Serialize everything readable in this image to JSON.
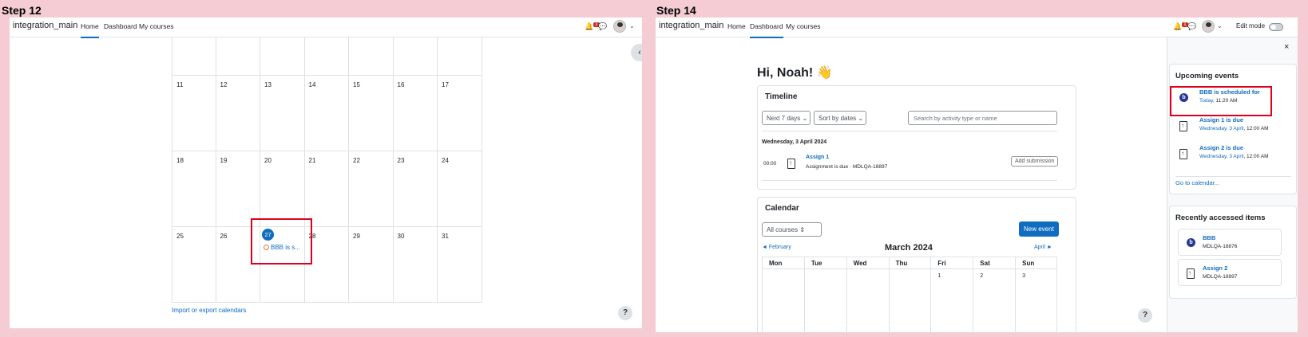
{
  "step12": {
    "label": "Step 12",
    "navbar": {
      "site_name": "integration_main",
      "items": [
        "Home",
        "Dashboard",
        "My courses"
      ],
      "notifications_count": "1"
    },
    "calendar_rows": [
      [
        "",
        "",
        "",
        "",
        "",
        "",
        ""
      ],
      [
        "11",
        "12",
        "13",
        "14",
        "15",
        "16",
        "17"
      ],
      [
        "18",
        "19",
        "20",
        "21",
        "22",
        "23",
        "24"
      ],
      [
        "25",
        "26",
        "27",
        "28",
        "29",
        "30",
        "31"
      ]
    ],
    "today_day": "27",
    "event_label": "BBB is s...",
    "import_export_link": "Import or export calendars",
    "help_label": "?"
  },
  "step14": {
    "label": "Step 14",
    "navbar": {
      "site_name": "integration_main",
      "items": [
        "Home",
        "Dashboard",
        "My courses"
      ],
      "notifications_count": "1",
      "edit_mode_label": "Edit mode"
    },
    "greeting": "Hi, Noah! 👋",
    "timeline": {
      "title": "Timeline",
      "filter_days": "Next 7 days",
      "sort": "Sort by dates",
      "search_placeholder": "Search by activity type or name",
      "date_heading": "Wednesday, 3 April 2024",
      "item_time": "00:00",
      "item_title": "Assign 1",
      "item_subtitle": "Assignment is due · MDLQA-18897",
      "item_action": "Add submission"
    },
    "calendar": {
      "title": "Calendar",
      "course_filter": "All courses",
      "new_event": "New event",
      "prev_month": "February",
      "month": "March 2024",
      "next_month": "April",
      "weekdays": [
        "Mon",
        "Tue",
        "Wed",
        "Thu",
        "Fri",
        "Sat",
        "Sun"
      ],
      "first_row": [
        "",
        "",
        "",
        "",
        "1",
        "2",
        "3"
      ]
    },
    "drawer": {
      "close": "×",
      "upcoming_title": "Upcoming events",
      "events": [
        {
          "title": "BBB is scheduled for",
          "when_link": "Today",
          "when_rest": ", 11:20 AM"
        },
        {
          "title": "Assign 1 is due",
          "when_link": "Wednesday, 3 April",
          "when_rest": ", 12:00 AM"
        },
        {
          "title": "Assign 2 is due",
          "when_link": "Wednesday, 3 April",
          "when_rest": ", 12:00 AM"
        }
      ],
      "go_to_calendar": "Go to calendar...",
      "recent_title": "Recently accessed items",
      "recent": [
        {
          "name": "BBB",
          "course": "MDLQA-18876"
        },
        {
          "name": "Assign 2",
          "course": "MDLQA-18897"
        }
      ]
    },
    "help_label": "?"
  },
  "colors": {
    "background": "#f6ccd4",
    "accent": "#0f6cbf",
    "highlight": "#e0001b"
  }
}
